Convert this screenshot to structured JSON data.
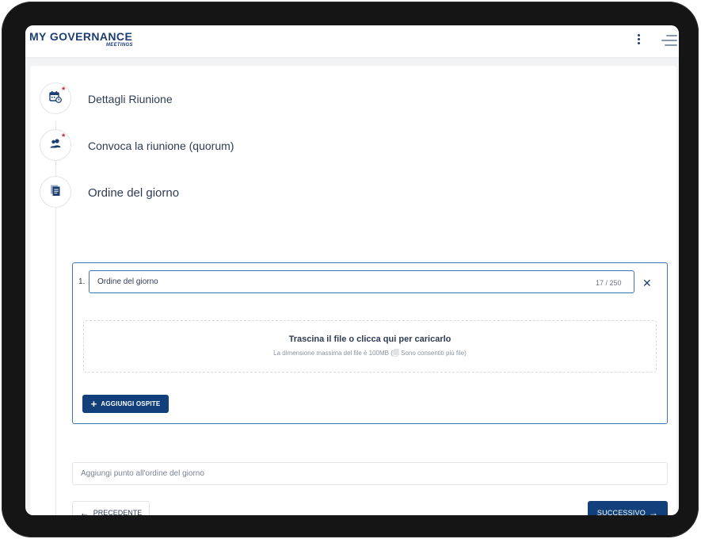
{
  "brand": {
    "name": "MY GOVERNANCE",
    "subtitle": "MEETINGS"
  },
  "steps": [
    {
      "label": "Dettagli Riunione",
      "icon": "calendar-clock-icon",
      "required": true
    },
    {
      "label": "Convoca la riunione (quorum)",
      "icon": "users-icon",
      "required": true
    },
    {
      "label": "Ordine del giorno",
      "icon": "document-icon",
      "required": false
    }
  ],
  "required_mark": "*",
  "agenda": {
    "item_number": "1.",
    "item_value": "Ordine del giorno",
    "item_counter": "17 / 250",
    "close_icon": "close-icon",
    "dropzone_title": "Trascina il file o clicca qui per caricarlo",
    "dropzone_subtitle": "La dimensione massima del file è 100MB (🗐 Sono consentiti più file)",
    "add_guest_label": "AGGIUNGI OSPITE"
  },
  "add_point_placeholder": "Aggiungi punto all'ordine del giorno",
  "nav": {
    "prev_label": "PRECEDENTE",
    "next_label": "SUCCESSIVO"
  },
  "colors": {
    "brand": "#1b3d6f",
    "primary": "#11407a",
    "required": "#c0262d",
    "active_border": "#3d74b8"
  }
}
